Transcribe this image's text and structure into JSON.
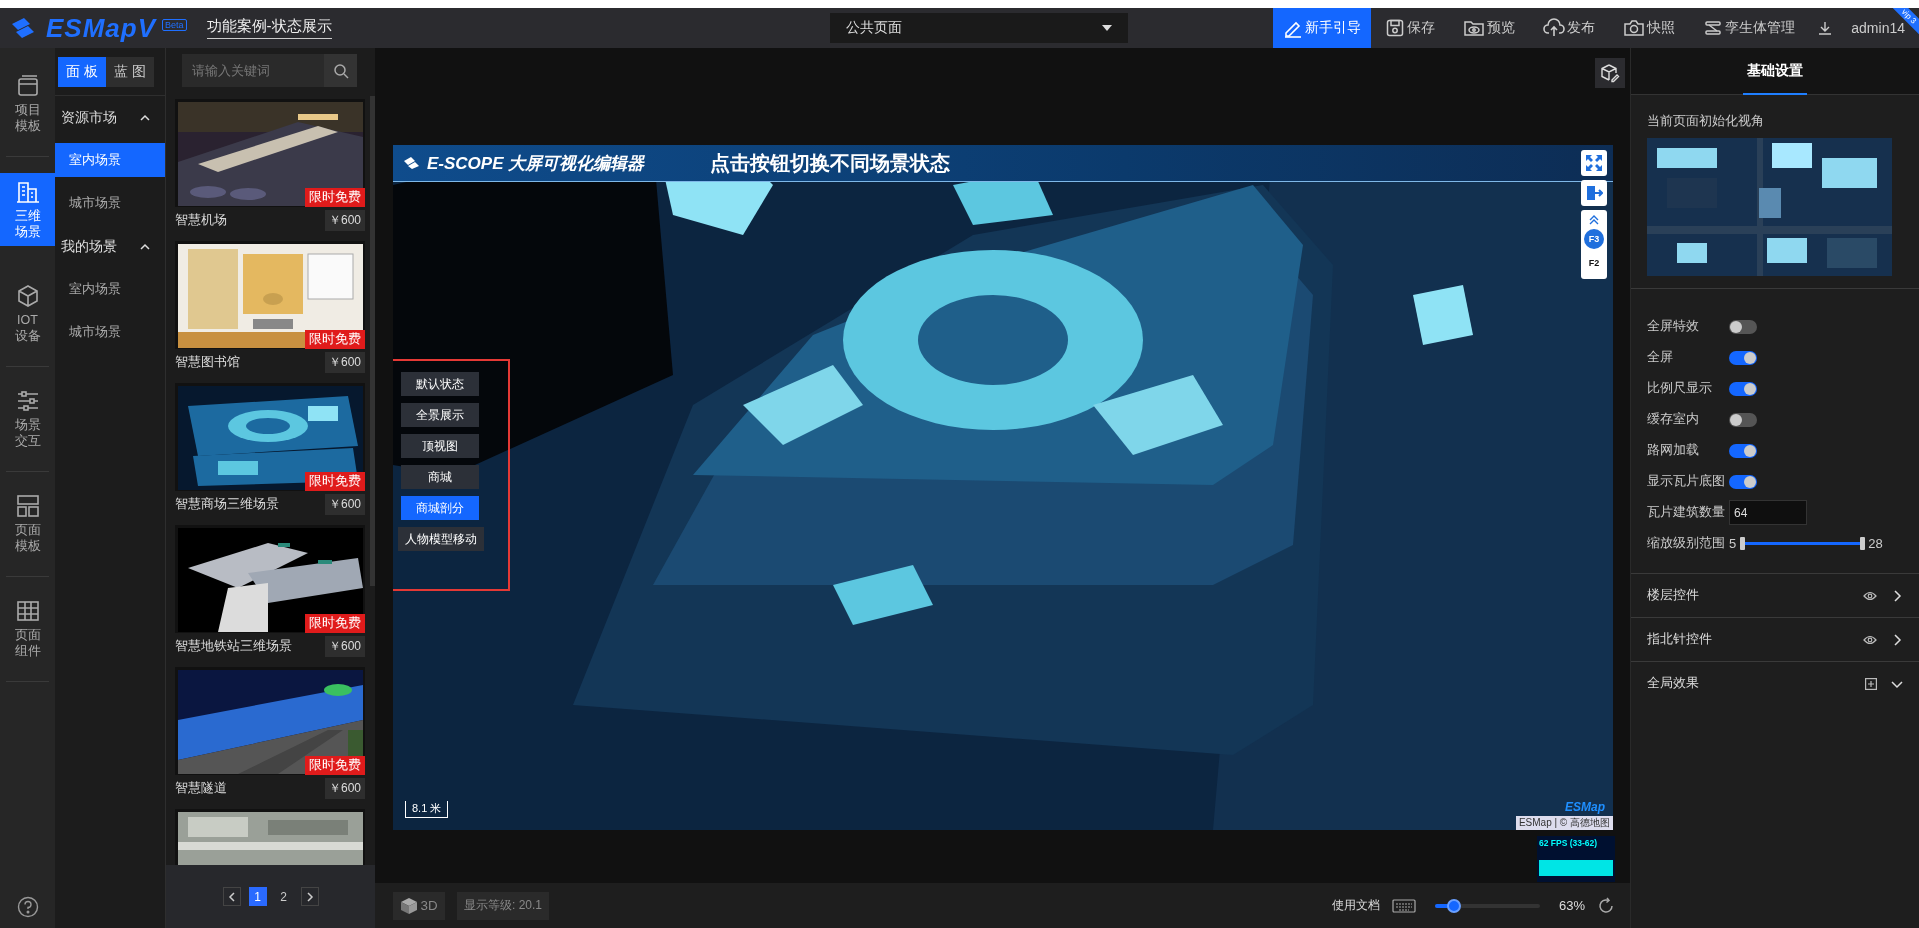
{
  "app": {
    "logo": "ESMapV",
    "badge": "Beta",
    "project_title": "功能案例-状态展示",
    "vip": "vip 3"
  },
  "page_select": {
    "value": "公共页面"
  },
  "toolbar": [
    {
      "label": "新手引导",
      "kind": "guide",
      "highlighted": true
    },
    {
      "label": "保存",
      "kind": "save",
      "highlighted": false
    },
    {
      "label": "预览",
      "kind": "preview",
      "highlighted": false
    },
    {
      "label": "发布",
      "kind": "publish",
      "highlighted": false
    },
    {
      "label": "快照",
      "kind": "snapshot",
      "highlighted": false
    },
    {
      "label": "孪生体管理",
      "kind": "twin",
      "highlighted": false
    }
  ],
  "user": "admin14",
  "nav_rail": [
    {
      "label": "项目模板",
      "kind": "template",
      "selected": false
    },
    {
      "label": "三维场景",
      "kind": "scene",
      "selected": true
    },
    {
      "label": "IOT设备",
      "kind": "iot",
      "selected": false
    },
    {
      "label": "场景交互",
      "kind": "interaction",
      "selected": false
    },
    {
      "label": "页面模板",
      "kind": "page-template",
      "selected": false
    },
    {
      "label": "页面组件",
      "kind": "component",
      "selected": false
    }
  ],
  "panel_tabs": [
    {
      "label": "面板",
      "selected": true
    },
    {
      "label": "蓝图",
      "selected": false
    }
  ],
  "tree": [
    {
      "label": "资源市场",
      "expanded": true,
      "children": [
        {
          "label": "室内场景",
          "selected": true
        },
        {
          "label": "城市场景",
          "selected": false
        }
      ]
    },
    {
      "label": "我的场景",
      "expanded": true,
      "children": [
        {
          "label": "室内场景",
          "selected": false
        },
        {
          "label": "城市场景",
          "selected": false
        }
      ]
    }
  ],
  "search": {
    "placeholder": "请输入关键词"
  },
  "scenes": [
    {
      "name": "智慧机场",
      "price": "￥600",
      "badge": "限时免费"
    },
    {
      "name": "智慧图书馆",
      "price": "￥600",
      "badge": "限时免费"
    },
    {
      "name": "智慧商场三维场景",
      "price": "￥600",
      "badge": "限时免费"
    },
    {
      "name": "智慧地铁站三维场景",
      "price": "￥600",
      "badge": "限时免费"
    },
    {
      "name": "智慧隧道",
      "price": "￥600",
      "badge": "限时免费"
    },
    {
      "kind": "picture"
    }
  ],
  "pagination": [
    {
      "label": "1",
      "selected": true
    },
    {
      "label": "2",
      "selected": false
    }
  ],
  "map": {
    "header_logo": "E-SCOPE 大屏可视化编辑器",
    "header_title": "点击按钮切换不同场景状态",
    "scene_buttons": [
      {
        "label": "默认状态",
        "selected": false
      },
      {
        "label": "全景展示",
        "selected": false
      },
      {
        "label": "顶视图",
        "selected": false
      },
      {
        "label": "商城",
        "selected": false
      },
      {
        "label": "商城剖分",
        "selected": true
      },
      {
        "label": "人物模型移动",
        "selected": false
      }
    ],
    "floors": [
      {
        "label": "F3",
        "selected": true
      },
      {
        "label": "F2",
        "selected": false
      }
    ],
    "scale": "8.1 米",
    "logo": "ESMap",
    "attribution": "ESMap | © 高德地图"
  },
  "fps": "62 FPS (33-62)",
  "bottom_bar": {
    "mode": "3D",
    "zoom_readout": "显示等级: 20.1",
    "docs_link": "使用文档",
    "zoom_slider": {
      "level": 0.18
    },
    "zoom_percent": "63%"
  },
  "settings": {
    "tab": "基础设置",
    "view_label": "当前页面初始化视角",
    "rows": [
      {
        "kind": "toggle",
        "label": "全屏特效",
        "on": false
      },
      {
        "kind": "toggle",
        "label": "全屏",
        "on": true
      },
      {
        "kind": "toggle",
        "label": "比例尺显示",
        "on": true
      },
      {
        "kind": "toggle",
        "label": "缓存室内",
        "on": false
      },
      {
        "kind": "toggle",
        "label": "路网加载",
        "on": true
      },
      {
        "kind": "toggle",
        "label": "显示瓦片底图",
        "on": true
      },
      {
        "kind": "number",
        "label": "瓦片建筑数量",
        "value": "64"
      },
      {
        "kind": "range",
        "label": "缩放级别范围",
        "min": "5",
        "max": "28",
        "thumbs": [
          {
            "level": 0
          },
          {
            "level": 1
          }
        ]
      }
    ],
    "sections": [
      {
        "label": "楼层控件",
        "kind": "visibility"
      },
      {
        "label": "指北针控件",
        "kind": "visibility"
      },
      {
        "label": "全局效果",
        "kind": "add"
      }
    ]
  }
}
